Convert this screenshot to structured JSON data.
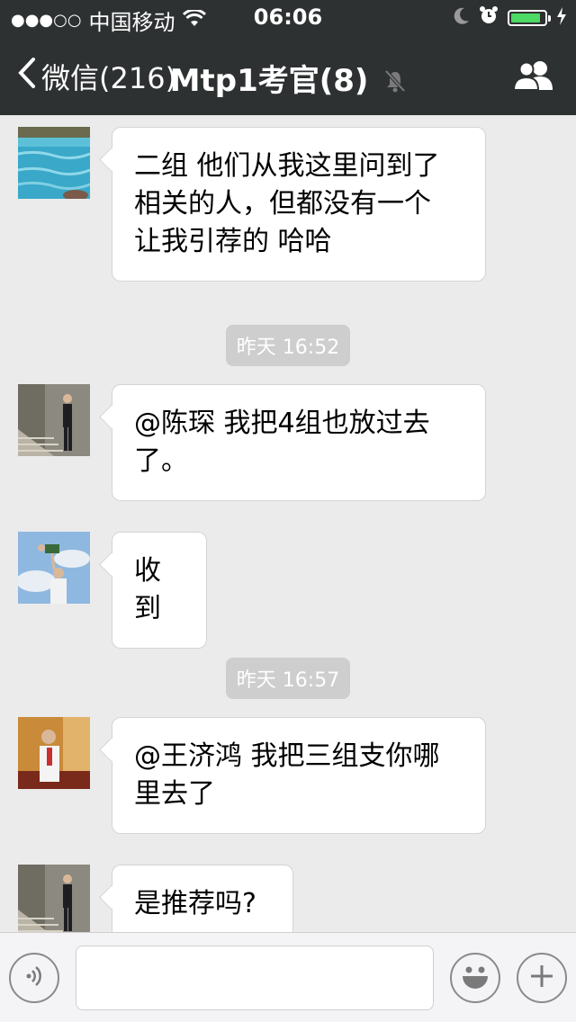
{
  "status_bar": {
    "signal": "●●●○○",
    "carrier": "中国移动",
    "time": "06:06",
    "icons": [
      "wifi-icon",
      "moon-icon",
      "alarm-icon",
      "battery-icon",
      "charging-icon"
    ],
    "battery_level": 0.8
  },
  "navbar": {
    "back_label": "微信(216)",
    "title": "Mtp1考官(8)",
    "icons": [
      "chevron-left-icon",
      "mute-bell-icon",
      "group-members-icon"
    ]
  },
  "chat": {
    "messages": [
      {
        "text_lines": [
          "二组  他们从我这里问到了",
          "相关的人，但都没有一个",
          "让我引荐的 哈哈"
        ]
      },
      {
        "time": "昨天 16:52"
      },
      {
        "text_lines": [
          "@陈琛 我把4组也放过去",
          "了。"
        ]
      },
      {
        "text_lines": [
          "收到"
        ]
      },
      {
        "time": "昨天 16:57"
      },
      {
        "text_lines": [
          "@王济鸿 我把三组支你哪",
          "里去了"
        ]
      },
      {
        "text_lines": [
          "是推荐吗?"
        ]
      }
    ]
  },
  "inputbar": {
    "text_value": "",
    "icons": [
      "voice-icon",
      "emoji-icon",
      "plus-icon"
    ]
  },
  "colors": {
    "bar_bg": "#2e3132",
    "chat_bg": "#ebebeb",
    "battery_green": "#4cd964",
    "timestamp_bg": "#cecece"
  }
}
